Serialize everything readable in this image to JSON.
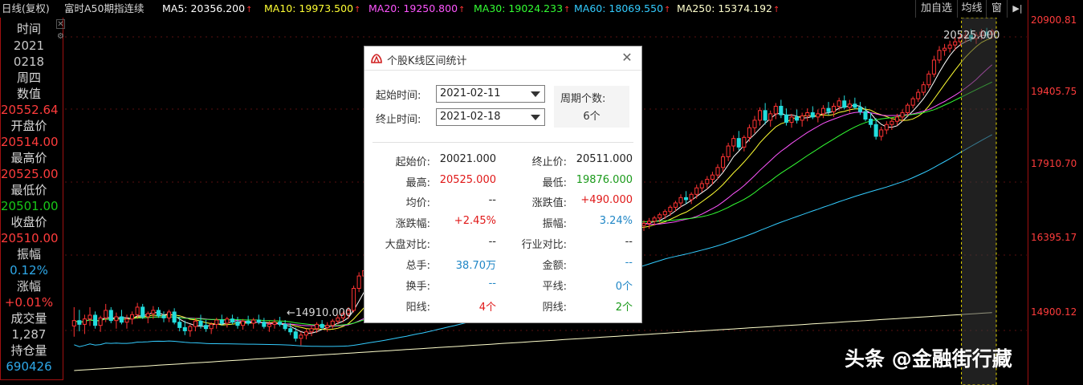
{
  "topbar": {
    "period": "日线(复权)",
    "symbol": "富时A50期指连续",
    "ma5": "MA5: 20356.200",
    "ma10": "MA10: 19973.500",
    "ma20": "MA20: 19250.800",
    "ma30": "MA30: 19024.233",
    "ma60": "MA60: 18069.550",
    "ma250": "MA250: 15374.192",
    "arrow": "↑",
    "btn_watchlist": "加自选",
    "btn_ma": "均线",
    "btn_window": "窗",
    "btn_expand": "▶|"
  },
  "colors": {
    "ma5": "#ffffff",
    "ma10": "#ffff33",
    "ma20": "#ff55ff",
    "ma30": "#33ff33",
    "ma60": "#33ccff",
    "ma250": "#ffffcc",
    "up": "#ff3333",
    "down": "#22dddd",
    "axis": "#ff3c3c"
  },
  "left_panel": {
    "time_label": "时间",
    "year": "2021",
    "date": "0218",
    "weekday": "周四",
    "value_label": "数值",
    "value": "20552.64",
    "open_label": "开盘价",
    "open": "20514.00",
    "high_label": "最高价",
    "high": "20525.00",
    "low_label": "最低价",
    "low": "20501.00",
    "close_label": "收盘价",
    "close": "20510.00",
    "amplitude_label": "振幅",
    "amplitude": "0.12%",
    "change_label": "涨幅",
    "change": "+0.01%",
    "volume_label": "成交量",
    "volume": "1,287",
    "oi_label": "持仓量",
    "oi": "690426",
    "close_icon": "close-icon",
    "gear_icon": "gear-icon"
  },
  "price_axis": {
    "labels": [
      "20900.81",
      "19405.75",
      "17910.70",
      "16395.17",
      "14900.12"
    ]
  },
  "chart_annotations": {
    "high_marker": "20525.000",
    "low_marker": "←14910.000"
  },
  "chart_data": {
    "type": "candlestick",
    "ylim": [
      14400,
      21000
    ],
    "count": 175,
    "candles": [
      [
        15350,
        15700,
        15150,
        15450
      ],
      [
        15450,
        15650,
        15250,
        15380
      ],
      [
        15380,
        15560,
        15200,
        15480
      ],
      [
        15480,
        15700,
        15350,
        15550
      ],
      [
        15550,
        15620,
        15300,
        15360
      ],
      [
        15360,
        15540,
        15240,
        15500
      ],
      [
        15500,
        15760,
        15420,
        15640
      ],
      [
        15640,
        15700,
        15400,
        15450
      ],
      [
        15450,
        15600,
        15300,
        15520
      ],
      [
        15520,
        15650,
        15380,
        15420
      ],
      [
        15420,
        15560,
        15300,
        15480
      ],
      [
        15480,
        15620,
        15380,
        15560
      ],
      [
        15560,
        15780,
        15480,
        15700
      ],
      [
        15700,
        15760,
        15480,
        15520
      ],
      [
        15520,
        15620,
        15400,
        15580
      ],
      [
        15580,
        15720,
        15480,
        15640
      ],
      [
        15640,
        15700,
        15500,
        15540
      ],
      [
        15540,
        15620,
        15420,
        15500
      ],
      [
        15500,
        15650,
        15420,
        15610
      ],
      [
        15610,
        15680,
        15380,
        15420
      ],
      [
        15420,
        15520,
        15250,
        15320
      ],
      [
        15320,
        15450,
        15180,
        15260
      ],
      [
        15260,
        15380,
        15150,
        15340
      ],
      [
        15340,
        15500,
        15250,
        15440
      ],
      [
        15440,
        15560,
        15300,
        15360
      ],
      [
        15360,
        15460,
        15240,
        15300
      ],
      [
        15300,
        15420,
        15200,
        15380
      ],
      [
        15380,
        15500,
        15300,
        15460
      ],
      [
        15460,
        15560,
        15360,
        15400
      ],
      [
        15400,
        15520,
        15320,
        15480
      ],
      [
        15480,
        15560,
        15380,
        15420
      ],
      [
        15420,
        15520,
        15300,
        15360
      ],
      [
        15360,
        15480,
        15280,
        15440
      ],
      [
        15440,
        15540,
        15360,
        15400
      ],
      [
        15400,
        15500,
        15300,
        15460
      ],
      [
        15460,
        15560,
        15380,
        15420
      ],
      [
        15420,
        15500,
        15300,
        15340
      ],
      [
        15340,
        15440,
        15240,
        15380
      ],
      [
        15380,
        15480,
        15300,
        15420
      ],
      [
        15420,
        15520,
        15340,
        15380
      ],
      [
        15380,
        15460,
        15260,
        15300
      ],
      [
        15300,
        15400,
        15180,
        15240
      ],
      [
        15240,
        15320,
        15060,
        15120
      ],
      [
        15120,
        15240,
        14990,
        15180
      ],
      [
        15180,
        15300,
        15100,
        15240
      ],
      [
        15240,
        15360,
        15160,
        15300
      ],
      [
        15300,
        15420,
        15220,
        15380
      ],
      [
        15380,
        15460,
        15280,
        15320
      ],
      [
        15320,
        15420,
        15240,
        15360
      ],
      [
        15360,
        15480,
        15300,
        15440
      ],
      [
        15440,
        15560,
        15380,
        15500
      ],
      [
        15500,
        15620,
        15420,
        15580
      ],
      [
        15580,
        15700,
        15480,
        15640
      ],
      [
        15640,
        16100,
        15600,
        16050
      ],
      [
        16050,
        16350,
        15980,
        16280
      ],
      [
        16280,
        16450,
        16150,
        16380
      ],
      [
        16380,
        16520,
        16250,
        16440
      ],
      [
        16440,
        16560,
        16300,
        16360
      ],
      [
        16360,
        16480,
        16260,
        16420
      ],
      [
        16420,
        16560,
        16340,
        16500
      ],
      [
        16500,
        16620,
        16400,
        16560
      ],
      [
        16560,
        16680,
        16440,
        16500
      ],
      [
        16500,
        16620,
        16400,
        16580
      ],
      [
        16580,
        16700,
        16480,
        16640
      ],
      [
        16640,
        16760,
        16540,
        16700
      ],
      [
        16700,
        16820,
        16580,
        16640
      ],
      [
        16640,
        16760,
        16540,
        16720
      ],
      [
        16720,
        16840,
        16620,
        16780
      ],
      [
        16780,
        16900,
        16680,
        16840
      ],
      [
        16840,
        16960,
        16740,
        16900
      ],
      [
        16900,
        17020,
        16780,
        16860
      ],
      [
        16860,
        16980,
        16760,
        16940
      ],
      [
        16940,
        17060,
        16840,
        17000
      ],
      [
        17000,
        17120,
        16880,
        16960
      ],
      [
        16960,
        17080,
        16860,
        17040
      ],
      [
        17040,
        17160,
        16940,
        17100
      ],
      [
        17100,
        17220,
        16980,
        17060
      ],
      [
        17060,
        17180,
        16960,
        17140
      ],
      [
        17140,
        17260,
        17040,
        17200
      ],
      [
        17200,
        17320,
        17080,
        17160
      ],
      [
        17160,
        17280,
        17060,
        17240
      ],
      [
        17240,
        17360,
        17140,
        17300
      ],
      [
        17300,
        17420,
        17180,
        17260
      ],
      [
        17260,
        17380,
        17160,
        17340
      ],
      [
        17340,
        17460,
        17240,
        17400
      ],
      [
        17400,
        17520,
        17280,
        17360
      ],
      [
        17360,
        17480,
        17260,
        17440
      ],
      [
        17440,
        17560,
        17340,
        17500
      ],
      [
        17500,
        17620,
        17380,
        17460
      ],
      [
        17460,
        17580,
        17360,
        17540
      ],
      [
        17540,
        17620,
        17400,
        17440
      ],
      [
        17440,
        17520,
        17260,
        17300
      ],
      [
        17300,
        17400,
        17160,
        17220
      ],
      [
        17220,
        17340,
        17120,
        17280
      ],
      [
        17280,
        17400,
        17180,
        17340
      ],
      [
        17340,
        17440,
        17200,
        17240
      ],
      [
        17240,
        17360,
        17140,
        17300
      ],
      [
        17300,
        17420,
        17220,
        17380
      ],
      [
        17380,
        17460,
        17240,
        17260
      ],
      [
        17260,
        17340,
        17080,
        17120
      ],
      [
        17120,
        17240,
        16980,
        17060
      ],
      [
        17060,
        17180,
        16940,
        17140
      ],
      [
        17140,
        17260,
        17040,
        17200
      ],
      [
        17200,
        17300,
        17080,
        17120
      ],
      [
        17120,
        17240,
        17020,
        17180
      ],
      [
        17180,
        17300,
        17100,
        17240
      ],
      [
        17240,
        17360,
        17160,
        17320
      ],
      [
        17320,
        17380,
        17180,
        17220
      ],
      [
        17220,
        17320,
        17120,
        17260
      ],
      [
        17260,
        17360,
        17160,
        17300
      ],
      [
        17300,
        17400,
        17220,
        17360
      ],
      [
        17360,
        17460,
        17280,
        17420
      ],
      [
        17420,
        17520,
        17340,
        17480
      ],
      [
        17480,
        17600,
        17400,
        17560
      ],
      [
        17560,
        17680,
        17480,
        17640
      ],
      [
        17640,
        17800,
        17560,
        17740
      ],
      [
        17740,
        17860,
        17620,
        17700
      ],
      [
        17700,
        17840,
        17620,
        17800
      ],
      [
        17800,
        17980,
        17720,
        17920
      ],
      [
        17920,
        18060,
        17840,
        18000
      ],
      [
        18000,
        18140,
        17900,
        18080
      ],
      [
        18080,
        18220,
        17980,
        18160
      ],
      [
        18160,
        18360,
        18080,
        18300
      ],
      [
        18300,
        18560,
        18220,
        18500
      ],
      [
        18500,
        18760,
        18420,
        18700
      ],
      [
        18700,
        18900,
        18600,
        18840
      ],
      [
        18840,
        18980,
        18620,
        18680
      ],
      [
        18680,
        18900,
        18600,
        18860
      ],
      [
        18860,
        19100,
        18780,
        19040
      ],
      [
        19040,
        19260,
        18940,
        19180
      ],
      [
        19180,
        19420,
        19080,
        19360
      ],
      [
        19360,
        19500,
        19100,
        19180
      ],
      [
        19180,
        19360,
        19060,
        19300
      ],
      [
        19300,
        19500,
        19200,
        19440
      ],
      [
        19440,
        19560,
        19220,
        19280
      ],
      [
        19280,
        19400,
        19080,
        19140
      ],
      [
        19140,
        19300,
        19040,
        19240
      ],
      [
        19240,
        19380,
        19120,
        19180
      ],
      [
        19180,
        19320,
        19060,
        19260
      ],
      [
        19260,
        19400,
        19160,
        19320
      ],
      [
        19320,
        19440,
        19200,
        19240
      ],
      [
        19240,
        19380,
        19140,
        19300
      ],
      [
        19300,
        19460,
        19220,
        19400
      ],
      [
        19400,
        19520,
        19280,
        19340
      ],
      [
        19340,
        19500,
        19240,
        19440
      ],
      [
        19440,
        19600,
        19360,
        19540
      ],
      [
        19540,
        19640,
        19380,
        19420
      ],
      [
        19420,
        19560,
        19320,
        19480
      ],
      [
        19480,
        19600,
        19380,
        19420
      ],
      [
        19420,
        19520,
        19280,
        19340
      ],
      [
        19340,
        19440,
        19160,
        19200
      ],
      [
        19200,
        19320,
        19040,
        19100
      ],
      [
        19100,
        19220,
        18820,
        18880
      ],
      [
        18880,
        19060,
        18800,
        19000
      ],
      [
        19000,
        19160,
        18920,
        19100
      ],
      [
        19100,
        19220,
        19000,
        19160
      ],
      [
        19160,
        19300,
        19080,
        19240
      ],
      [
        19240,
        19380,
        19160,
        19320
      ],
      [
        19320,
        19500,
        19260,
        19460
      ],
      [
        19460,
        19620,
        19400,
        19580
      ],
      [
        19580,
        19760,
        19520,
        19700
      ],
      [
        19700,
        19900,
        19640,
        19840
      ],
      [
        19840,
        20100,
        19780,
        20040
      ],
      [
        20040,
        20380,
        19980,
        20300
      ],
      [
        20300,
        20560,
        20240,
        20480
      ],
      [
        20480,
        20600,
        20380,
        20520
      ],
      [
        20520,
        20660,
        20440,
        20580
      ],
      [
        20580,
        20720,
        20480,
        20640
      ],
      [
        20640,
        20800,
        20560,
        20720
      ],
      [
        20720,
        20860,
        20620,
        20760
      ],
      [
        20760,
        20880,
        20640,
        20700
      ],
      [
        20700,
        20820,
        20600,
        20760
      ],
      [
        20760,
        20880,
        20680,
        20820
      ],
      [
        20820,
        20900,
        20700,
        20780
      ],
      [
        20780,
        20880,
        20700,
        20840
      ]
    ]
  },
  "dialog": {
    "title": "个股K线区间统计",
    "start_label": "起始时间:",
    "start_value": "2021-02-11",
    "end_label": "终止时间:",
    "end_value": "2021-02-18",
    "period_label": "周期个数:",
    "period_value": "6个",
    "rows": [
      {
        "l1": "起始价:",
        "v1": "20021.000",
        "c1": "black",
        "l2": "终止价:",
        "v2": "20511.000",
        "c2": "black"
      },
      {
        "l1": "最高:",
        "v1": "20525.000",
        "c1": "red",
        "l2": "最低:",
        "v2": "19876.000",
        "c2": "green"
      },
      {
        "l1": "均价:",
        "v1": "--",
        "c1": "black",
        "l2": "涨跌值:",
        "v2": "+490.000",
        "c2": "red"
      },
      {
        "l1": "涨跌幅:",
        "v1": "+2.45%",
        "c1": "red",
        "l2": "振幅:",
        "v2": "3.24%",
        "c2": "blue"
      },
      {
        "l1": "大盘对比:",
        "v1": "--",
        "c1": "black",
        "l2": "行业对比:",
        "v2": "--",
        "c2": "black"
      },
      {
        "l1": "总手:",
        "v1": "38.70万",
        "c1": "blue",
        "l2": "金额:",
        "v2": "--",
        "c2": "blue"
      },
      {
        "l1": "换手:",
        "v1": "--",
        "c1": "blue",
        "l2": "平线:",
        "v2": "0个",
        "c2": "blue"
      },
      {
        "l1": "阳线:",
        "v1": "4个",
        "c1": "red",
        "l2": "阴线:",
        "v2": "2个",
        "c2": "green"
      }
    ]
  },
  "watermark": "头条 @金融街行藏"
}
